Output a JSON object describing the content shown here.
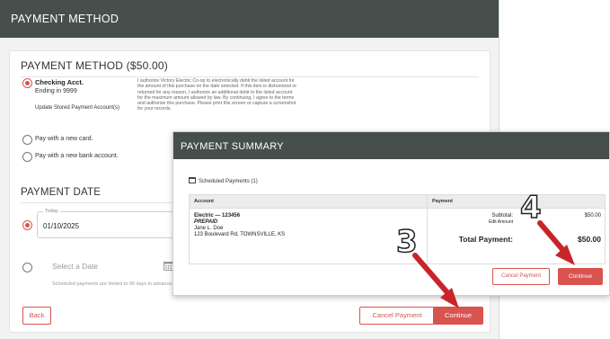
{
  "method_window": {
    "header": "PAYMENT METHOD",
    "section_title": "PAYMENT METHOD ($50.00)",
    "checking": {
      "name": "Checking Acct.",
      "ending": "Ending in 9999",
      "update_link": "Update Stored Payment Account(s)"
    },
    "authorization_text": "I authorize Victory Electric Co-op to electronically debit the listed account for the amount of this purchase on the date selected. If this item is dishonored or returned for any reason, I authorize an additional debit to the listed account for the maximum amount allowed by law. By continuing, I agree to the terms and authorize this purchase. Please print this screen or capture a screenshot for your records.",
    "options": {
      "new_card": "Pay with a new card.",
      "new_bank": "Pay with a new bank account."
    },
    "payment_date": {
      "title": "PAYMENT DATE",
      "field_legend": "Today",
      "field_value": "01/10/2025",
      "select_date": "Select a Date",
      "limit_note": "Scheduled payments are limited to 90 days in advance."
    },
    "buttons": {
      "back": "Back",
      "cancel": "Cancel Payment",
      "continue": "Continue"
    }
  },
  "summary_window": {
    "header": "PAYMENT SUMMARY",
    "scheduled_label": "Scheduled Payments (1)",
    "table": {
      "col_account": "Account",
      "col_payment": "Payment",
      "account_line": "Electric — 123456",
      "account_type": "PREPAID",
      "holder": "Jane L. Doe",
      "address": "123 Boulevard Rd, TOWNSVILLE, KS",
      "subtotal_label": "Subtotal:",
      "subtotal_value": "$50.00",
      "edit_amount": "Edit Amount",
      "total_label": "Total Payment:",
      "total_value": "$50.00"
    },
    "buttons": {
      "cancel": "Cancel Payment",
      "continue": "Continue"
    }
  },
  "annotations": {
    "step3": "3",
    "step4": "4"
  },
  "colors": {
    "header_bg": "#464f4c",
    "accent": "#d9534f",
    "arrow": "#c8252b"
  }
}
